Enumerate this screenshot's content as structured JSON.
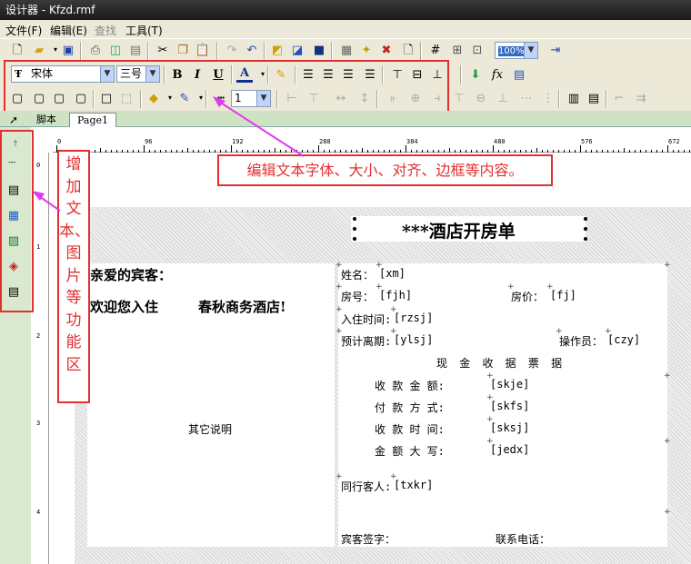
{
  "window": {
    "title": "设计器 - Kfzd.rmf"
  },
  "menu": [
    "文件(F)",
    "编辑(E)",
    "查找",
    "工具(T)"
  ],
  "toolbar": {
    "zoom": "100%",
    "font_name": "宋体",
    "font_size": "三号",
    "line_width": "1",
    "bold": "B",
    "italic": "I",
    "underline": "U",
    "font_color": "A",
    "fx": "fx"
  },
  "tabs": [
    "脚本",
    "Page1"
  ],
  "ruler": {
    "h_ticks": [
      "0",
      "96",
      "192",
      "288",
      "384",
      "480",
      "576",
      "672"
    ],
    "v_ticks": [
      "0",
      "1",
      "2",
      "3",
      "4"
    ]
  },
  "annotations": {
    "left": "增加文本、图片等功能区",
    "right": "编辑文本字体、大小、对齐、边框等内容。"
  },
  "report": {
    "title": "***酒店开房单",
    "greeting": "亲爱的宾客：",
    "welcome": "欢迎您入住",
    "hotel": "春秋商务酒店!",
    "other": "其它说明",
    "name_label": "姓名：",
    "name_field": "[xm]",
    "room_label": "房号：",
    "room_field": "[fjh]",
    "price_label": "房价：",
    "price_field": "[fj]",
    "checkin_label": "入住时间:",
    "checkin_field": "[rzsj]",
    "checkout_label": "预计离期:",
    "checkout_field": "[ylsj]",
    "operator_label": "操作员：",
    "operator_field": "[czy]",
    "receipt_title": "现 金 收 据 票 据",
    "amount_label": "收 款 金 额:",
    "amount_field": "[skje]",
    "method_label": "付 款 方 式:",
    "method_field": "[skfs]",
    "time_label": "收 款 时 间:",
    "time_field": "[sksj]",
    "capital_label": "金 额 大 写:",
    "capital_field": "[jedx]",
    "companion_label": "同行客人:",
    "companion_field": "[txkr]",
    "signature_label": "宾客签字：",
    "phone_label": "联系电话："
  }
}
